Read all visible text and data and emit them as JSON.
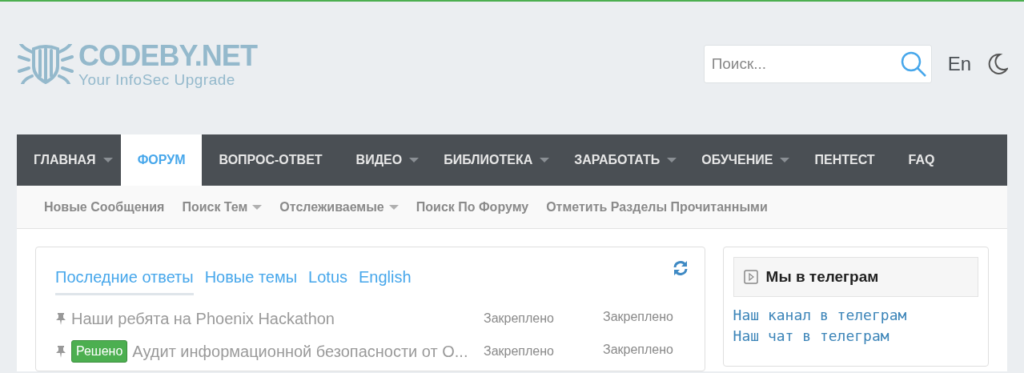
{
  "logo": {
    "name": "CODEBY.NET",
    "tagline": "Your InfoSec Upgrade"
  },
  "search": {
    "placeholder": "Поиск..."
  },
  "language": "En",
  "nav": [
    {
      "label": "ГЛАВНАЯ",
      "selected": false,
      "has_menu": true
    },
    {
      "label": "ФОРУМ",
      "selected": true,
      "has_menu": false
    },
    {
      "label": "ВОПРОС-ОТВЕТ",
      "selected": false,
      "has_menu": false
    },
    {
      "label": "ВИДЕО",
      "selected": false,
      "has_menu": true
    },
    {
      "label": "БИБЛИОТЕКА",
      "selected": false,
      "has_menu": true
    },
    {
      "label": "ЗАРАБОТАТЬ",
      "selected": false,
      "has_menu": true
    },
    {
      "label": "ОБУЧЕНИЕ",
      "selected": false,
      "has_menu": true
    },
    {
      "label": "ПЕНТЕСТ",
      "selected": false,
      "has_menu": false
    },
    {
      "label": "FAQ",
      "selected": false,
      "has_menu": false
    }
  ],
  "subnav": [
    {
      "label": "Новые Сообщения",
      "has_menu": false
    },
    {
      "label": "Поиск Тем",
      "has_menu": true
    },
    {
      "label": "Отслеживаемые",
      "has_menu": true
    },
    {
      "label": "Поиск По Форуму",
      "has_menu": false
    },
    {
      "label": "Отметить Разделы Прочитанными",
      "has_menu": false
    }
  ],
  "threads": {
    "tabs": [
      {
        "label": "Последние ответы",
        "selected": true
      },
      {
        "label": "Новые темы",
        "selected": false
      },
      {
        "label": "Lotus",
        "selected": false
      },
      {
        "label": "English",
        "selected": false
      }
    ],
    "rows": [
      {
        "pinned": true,
        "title": "Наши ребята на Phoenix Hackathon",
        "column_2": "Закреплено",
        "column_3": "Закреплено"
      },
      {
        "pinned": true,
        "badge": "Решено",
        "title": "Аудит информационной безопасности от О...",
        "column_2": "Закреплено",
        "column_3": "Закреплено"
      }
    ]
  },
  "telegram": {
    "title": "Мы в телеграм",
    "links": [
      "Наш канал в телеграм",
      "Наш чат в телеграм"
    ]
  }
}
